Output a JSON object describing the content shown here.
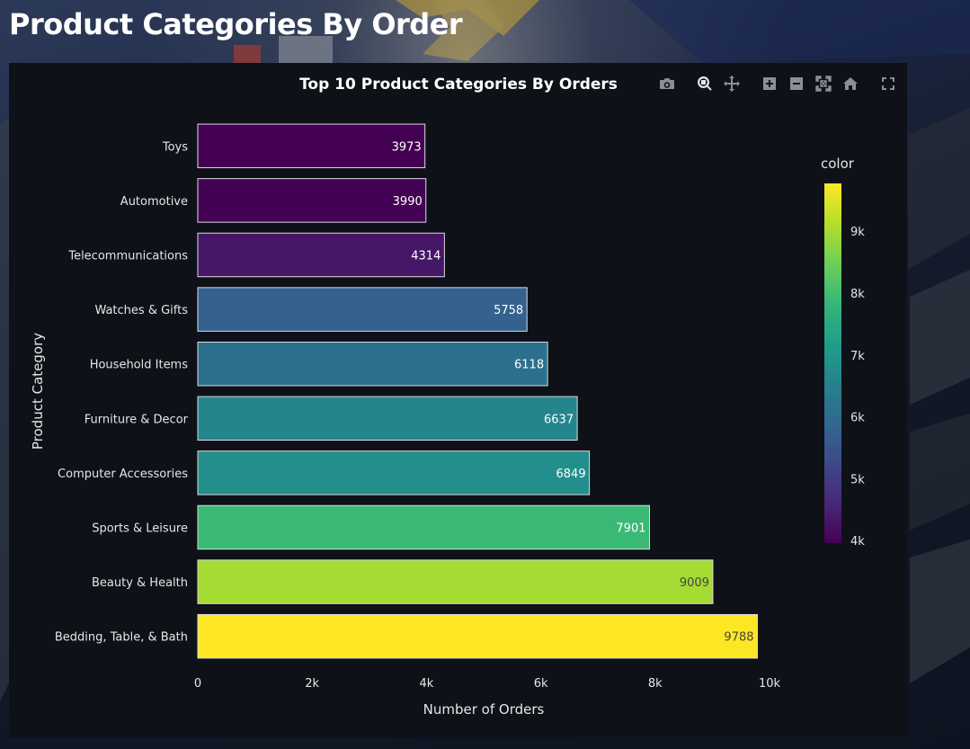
{
  "page": {
    "title": "Product Categories By Order"
  },
  "modebar": {
    "icons": [
      "camera-icon",
      "zoom-icon",
      "pan-icon",
      "zoom-in-icon",
      "zoom-out-icon",
      "autoscale-icon",
      "home-icon",
      "fullscreen-icon"
    ]
  },
  "chart_data": {
    "type": "bar",
    "orientation": "horizontal",
    "title": "Top 10 Product Categories By Orders",
    "xlabel": "Number of Orders",
    "ylabel": "Product Category",
    "categories": [
      "Toys",
      "Automotive",
      "Telecommunications",
      "Watches & Gifts",
      "Household Items",
      "Furniture & Decor",
      "Computer Accessories",
      "Sports & Leisure",
      "Beauty & Health",
      "Bedding, Table, & Bath"
    ],
    "values": [
      3973,
      3990,
      4314,
      5758,
      6118,
      6637,
      6849,
      7901,
      9009,
      9788
    ],
    "xlim": [
      0,
      10000
    ],
    "xticks": [
      0,
      2000,
      4000,
      6000,
      8000,
      10000
    ],
    "xtick_labels": [
      "0",
      "2k",
      "4k",
      "6k",
      "8k",
      "10k"
    ],
    "grid": false,
    "colorbar": {
      "title": "color",
      "range": [
        3973,
        9788
      ],
      "ticks": [
        4000,
        5000,
        6000,
        7000,
        8000,
        9000
      ],
      "tick_labels": [
        "4k",
        "5k",
        "6k",
        "7k",
        "8k",
        "9k"
      ],
      "colorscale": "Viridis"
    },
    "colors": {
      "background": "#0e1117",
      "text": "#ffffff",
      "axis_text": "#e6e6e6",
      "bar_outline": "#d9dbe0"
    }
  }
}
